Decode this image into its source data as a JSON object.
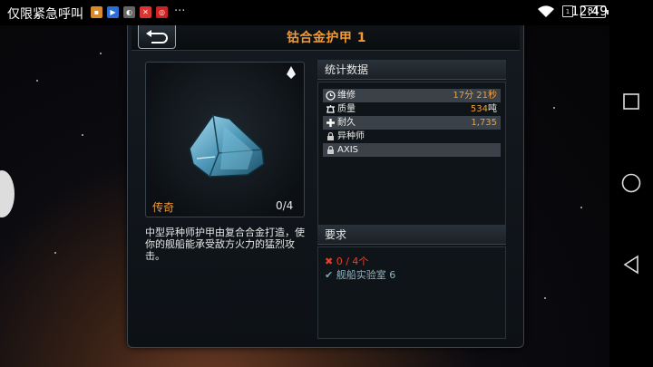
{
  "status_bar": {
    "carrier": "仅限紧急呼叫",
    "more": "···",
    "sim_label": "1",
    "battery": "81",
    "time": "12:49"
  },
  "header": {
    "title": "钴合金护甲 1"
  },
  "item": {
    "rarity": "传奇",
    "count": "0/4",
    "description": "中型异种师护甲由复合合金打造，使你的舰船能承受敌方火力的猛烈攻击。"
  },
  "stats": {
    "title": "统计数据",
    "rows": [
      {
        "icon": "clock-icon",
        "label": "维修",
        "value": "17分 21秒",
        "unit": "",
        "shaded": true
      },
      {
        "icon": "weight-icon",
        "label": "质量",
        "value": "534",
        "unit": "吨",
        "shaded": false
      },
      {
        "icon": "plus-icon",
        "label": "耐久",
        "value": "1,735",
        "unit": "",
        "shaded": true
      },
      {
        "icon": "lock-icon",
        "label": "异种师",
        "value": "",
        "unit": "",
        "shaded": false
      },
      {
        "icon": "lock-icon",
        "label": "AXIS",
        "value": "",
        "unit": "",
        "shaded": true
      }
    ]
  },
  "requirements": {
    "title": "要求",
    "items": [
      {
        "status": "unmet",
        "text": "0 / 4个"
      },
      {
        "status": "met",
        "text": "舰船实验室 6"
      }
    ]
  },
  "colors": {
    "accent": "#f19a36",
    "fail": "#e8402d",
    "ok": "#8fb3c1",
    "armor": "#6fb4cf"
  }
}
